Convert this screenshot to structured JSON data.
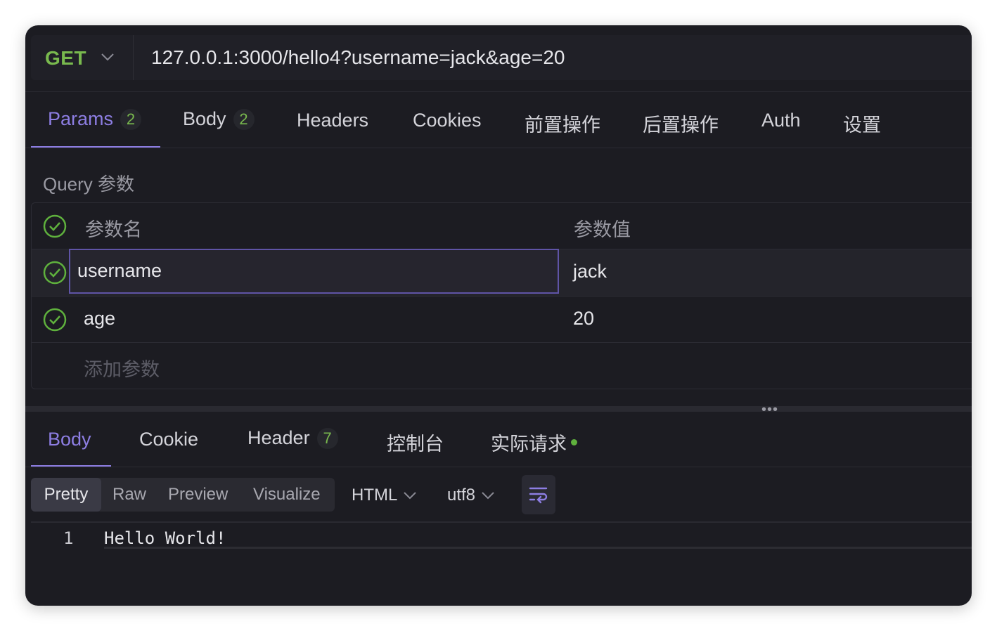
{
  "request": {
    "method": "GET",
    "url": "127.0.0.1:3000/hello4?username=jack&age=20"
  },
  "request_tabs": [
    {
      "label": "Params",
      "badge": "2",
      "active": true
    },
    {
      "label": "Body",
      "badge": "2",
      "active": false
    },
    {
      "label": "Headers",
      "active": false
    },
    {
      "label": "Cookies",
      "active": false
    },
    {
      "label": "前置操作",
      "active": false
    },
    {
      "label": "后置操作",
      "active": false
    },
    {
      "label": "Auth",
      "active": false
    },
    {
      "label": "设置",
      "active": false
    }
  ],
  "query": {
    "section_label": "Query 参数",
    "header": {
      "name": "参数名",
      "value": "参数值"
    },
    "rows": [
      {
        "name": "username",
        "value": "jack",
        "enabled": true
      },
      {
        "name": "age",
        "value": "20",
        "enabled": true
      }
    ],
    "add_placeholder": "添加参数"
  },
  "splitter_handle": "•••",
  "response_tabs": [
    {
      "label": "Body",
      "active": true
    },
    {
      "label": "Cookie",
      "active": false
    },
    {
      "label": "Header",
      "badge": "7",
      "active": false
    },
    {
      "label": "控制台",
      "active": false
    },
    {
      "label": "实际请求",
      "active": false,
      "status_dot": true
    }
  ],
  "view_modes": [
    {
      "label": "Pretty",
      "active": true
    },
    {
      "label": "Raw",
      "active": false
    },
    {
      "label": "Preview",
      "active": false
    },
    {
      "label": "Visualize",
      "active": false
    }
  ],
  "format_select": "HTML",
  "encoding_select": "utf8",
  "editor": {
    "lines": [
      {
        "number": "1",
        "text": "Hello World!"
      }
    ]
  },
  "colors": {
    "accent": "#8d7ee3",
    "method_get": "#79b94e",
    "background": "#1c1c22"
  }
}
